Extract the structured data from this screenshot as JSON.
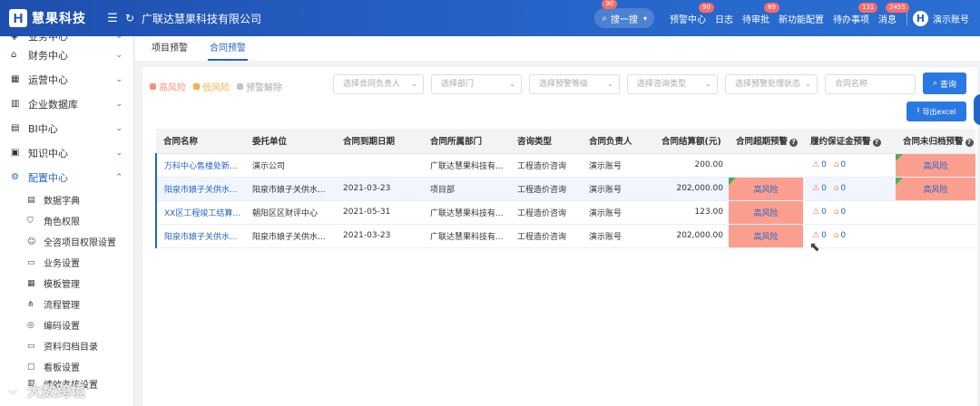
{
  "header": {
    "logo_letter": "H",
    "app_name": "慧果科技",
    "company": "广联达慧果科技有限公司",
    "search_label": "搜一搜",
    "search_badge": "90",
    "nav": [
      {
        "label": "预警中心",
        "badge": "90"
      },
      {
        "label": "日志",
        "badge": ""
      },
      {
        "label": "待审批",
        "badge": "89"
      },
      {
        "label": "新功能配置",
        "badge": ""
      },
      {
        "label": "待办事项",
        "badge": "131"
      },
      {
        "label": "消息",
        "badge": "2455"
      }
    ],
    "user_initial": "H",
    "user_name": "演示账号"
  },
  "sidebar": {
    "items": [
      {
        "label": "业务中心",
        "icon": "box-icon"
      },
      {
        "label": "财务中心",
        "icon": "bank-icon"
      },
      {
        "label": "运营中心",
        "icon": "building-icon"
      },
      {
        "label": "企业数据库",
        "icon": "bar-chart-icon"
      },
      {
        "label": "BI中心",
        "icon": "bi-chart-icon"
      },
      {
        "label": "知识中心",
        "icon": "book-icon"
      },
      {
        "label": "配置中心",
        "icon": "gear-icon"
      }
    ],
    "sub_items": [
      {
        "label": "数据字典",
        "icon": "dictionary-icon"
      },
      {
        "label": "角色权限",
        "icon": "shield-icon"
      },
      {
        "label": "全咨项目权限设置",
        "icon": "user-icon"
      },
      {
        "label": "业务设置",
        "icon": "briefcase-icon"
      },
      {
        "label": "模板管理",
        "icon": "template-icon"
      },
      {
        "label": "流程管理",
        "icon": "flow-icon"
      },
      {
        "label": "编码设置",
        "icon": "code-icon"
      },
      {
        "label": "资料归档目录",
        "icon": "archive-icon"
      },
      {
        "label": "看板设置",
        "icon": "dashboard-icon"
      },
      {
        "label": "绩效考核设置",
        "icon": "performance-icon"
      }
    ]
  },
  "watermark": "大数跨境",
  "tabs": [
    {
      "label": "项目预警",
      "active": false
    },
    {
      "label": "合同预警",
      "active": true
    }
  ],
  "legend": [
    {
      "label": "高风险",
      "color": "#f78f7f"
    },
    {
      "label": "低风险",
      "color": "#f5b04a"
    },
    {
      "label": "预警解除",
      "color": "#c0c4cc"
    }
  ],
  "filters": {
    "owner": "选择合同负责人",
    "department": "选择部门",
    "level": "选择预警等级",
    "consult_type": "选择咨询类型",
    "status": "选择预警处理状态",
    "contract_name": "合同名称",
    "query_label": "查询",
    "export_label": "导出excel"
  },
  "table": {
    "columns": [
      "合同名称",
      "委托单位",
      "合同到期日期",
      "合同所属部门",
      "咨询类型",
      "合同负责人",
      "合同结算额(元)",
      "合同超期预警",
      "履约保证金预警",
      "合同未归档预警"
    ],
    "rows": [
      {
        "name": "万科中心售楼处新...",
        "client": "演示公司",
        "due": "",
        "dept": "广联达慧果科技有...",
        "type": "工程造价咨询",
        "owner": "演示账号",
        "amount": "200.00",
        "overdue": "",
        "deposit_a": "0",
        "deposit_b": "0",
        "archive": "高风险"
      },
      {
        "name": "阳泉市娘子关供水...",
        "client": "阳泉市娘子关供水...",
        "due": "2021-03-23",
        "dept": "项目部",
        "type": "工程造价咨询",
        "owner": "演示账号",
        "amount": "202,000.00",
        "overdue": "高风险",
        "deposit_a": "0",
        "deposit_b": "0",
        "archive": "高风险"
      },
      {
        "name": "XX区工程竣工结算...",
        "client": "朝阳区区财评中心",
        "due": "2021-05-31",
        "dept": "广联达慧果科技有...",
        "type": "工程造价咨询",
        "owner": "演示账号",
        "amount": "123.00",
        "overdue": "高风险",
        "deposit_a": "0",
        "deposit_b": "0",
        "archive": ""
      },
      {
        "name": "阳泉市娘子关供水...",
        "client": "阳泉市娘子关供水...",
        "due": "2021-03-23",
        "dept": "广联达慧果科技有...",
        "type": "工程造价咨询",
        "owner": "演示账号",
        "amount": "202,000.00",
        "overdue": "高风险",
        "deposit_a": "0",
        "deposit_b": "0",
        "archive": ""
      }
    ]
  }
}
